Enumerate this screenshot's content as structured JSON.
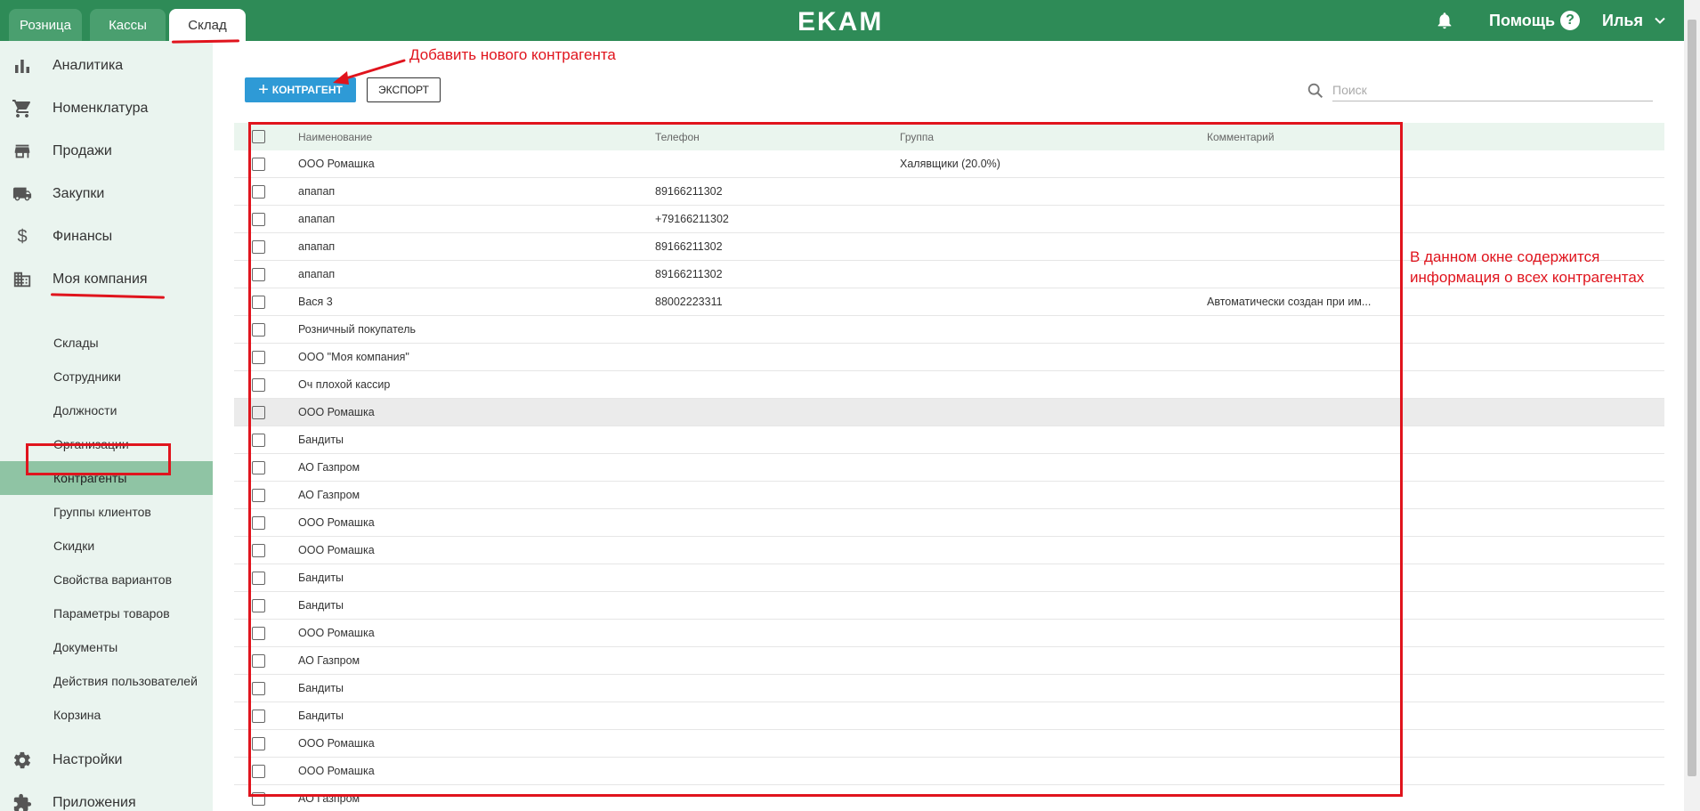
{
  "top_tabs": [
    {
      "label": "Розница"
    },
    {
      "label": "Кассы"
    },
    {
      "label": "Склад"
    }
  ],
  "brand": "EKAM",
  "header": {
    "help_label": "Помощь",
    "user_name": "Илья"
  },
  "sidebar": {
    "main_items": [
      {
        "label": "Аналитика",
        "icon": "bar-chart-icon"
      },
      {
        "label": "Номенклатура",
        "icon": "cart-icon"
      },
      {
        "label": "Продажи",
        "icon": "store-icon"
      },
      {
        "label": "Закупки",
        "icon": "truck-icon"
      },
      {
        "label": "Финансы",
        "icon": "dollar-icon"
      },
      {
        "label": "Моя компания",
        "icon": "building-icon"
      }
    ],
    "sub_items": [
      {
        "label": "Склады"
      },
      {
        "label": "Сотрудники"
      },
      {
        "label": "Должности"
      },
      {
        "label": "Организации"
      },
      {
        "label": "Контрагенты",
        "active": true
      },
      {
        "label": "Группы клиентов"
      },
      {
        "label": "Скидки"
      },
      {
        "label": "Свойства вариантов"
      },
      {
        "label": "Параметры товаров"
      },
      {
        "label": "Документы"
      },
      {
        "label": "Действия пользователей"
      },
      {
        "label": "Корзина"
      }
    ],
    "bottom_items": [
      {
        "label": "Настройки",
        "icon": "gear-icon"
      },
      {
        "label": "Приложения",
        "icon": "puzzle-icon"
      }
    ]
  },
  "toolbar": {
    "add_label": "КОНТРАГЕНТ",
    "export_label": "ЭКСПОРТ",
    "search_placeholder": "Поиск"
  },
  "table": {
    "columns": [
      "Наименование",
      "Телефон",
      "Группа",
      "Комментарий"
    ],
    "rows": [
      {
        "name": "ООО Ромашка",
        "phone": "",
        "group": "Халявщики (20.0%)",
        "comment": ""
      },
      {
        "name": "апапап",
        "phone": "89166211302",
        "group": "",
        "comment": ""
      },
      {
        "name": "апапап",
        "phone": "+79166211302",
        "group": "",
        "comment": ""
      },
      {
        "name": "апапап",
        "phone": "89166211302",
        "group": "",
        "comment": ""
      },
      {
        "name": "апапап",
        "phone": "89166211302",
        "group": "",
        "comment": ""
      },
      {
        "name": "Вася 3",
        "phone": "88002223311",
        "group": "",
        "comment": "Автоматически создан при им..."
      },
      {
        "name": "Розничный покупатель",
        "phone": "",
        "group": "",
        "comment": ""
      },
      {
        "name": "ООО \"Моя компания\"",
        "phone": "",
        "group": "",
        "comment": ""
      },
      {
        "name": "Оч плохой кассир",
        "phone": "",
        "group": "",
        "comment": ""
      },
      {
        "name": "ООО Ромашка",
        "phone": "",
        "group": "",
        "comment": "",
        "highlight": true
      },
      {
        "name": "Бандиты",
        "phone": "",
        "group": "",
        "comment": ""
      },
      {
        "name": "АО Газпром",
        "phone": "",
        "group": "",
        "comment": ""
      },
      {
        "name": "АО Газпром",
        "phone": "",
        "group": "",
        "comment": ""
      },
      {
        "name": "ООО Ромашка",
        "phone": "",
        "group": "",
        "comment": ""
      },
      {
        "name": "ООО Ромашка",
        "phone": "",
        "group": "",
        "comment": ""
      },
      {
        "name": "Бандиты",
        "phone": "",
        "group": "",
        "comment": ""
      },
      {
        "name": "Бандиты",
        "phone": "",
        "group": "",
        "comment": ""
      },
      {
        "name": "ООО Ромашка",
        "phone": "",
        "group": "",
        "comment": ""
      },
      {
        "name": "АО Газпром",
        "phone": "",
        "group": "",
        "comment": ""
      },
      {
        "name": "Бандиты",
        "phone": "",
        "group": "",
        "comment": ""
      },
      {
        "name": "Бандиты",
        "phone": "",
        "group": "",
        "comment": ""
      },
      {
        "name": "ООО Ромашка",
        "phone": "",
        "group": "",
        "comment": ""
      },
      {
        "name": "ООО Ромашка",
        "phone": "",
        "group": "",
        "comment": ""
      },
      {
        "name": "АО Газпром",
        "phone": "",
        "group": "",
        "comment": ""
      }
    ]
  },
  "annotations": {
    "add_hint": "Добавить нового контрагента",
    "window_hint_line1": "В данном окне содержится",
    "window_hint_line2": "информация о всех контрагентах"
  },
  "colors": {
    "brand_green": "#2e8b57",
    "primary_blue": "#2e9ad6",
    "annotation_red": "#e0141d",
    "active_sidebar": "#8fc4a4"
  }
}
